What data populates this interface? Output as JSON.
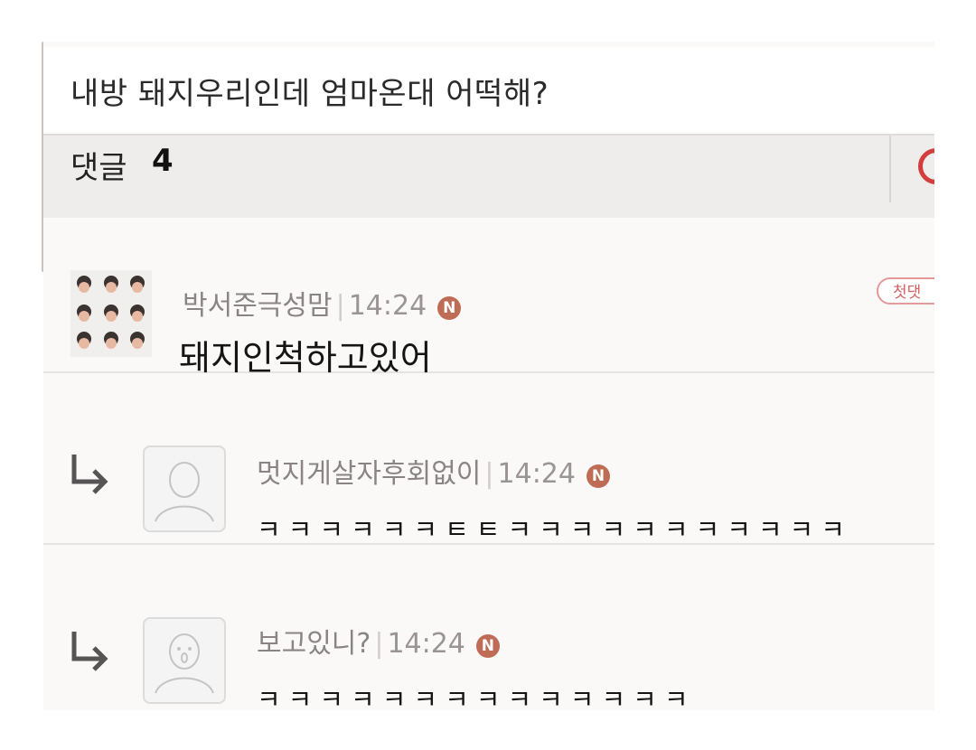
{
  "post": {
    "title": "내방 돼지우리인데 엄마온대 어떡해?"
  },
  "comments_bar": {
    "label": "댓글",
    "count": "4"
  },
  "comments": [
    {
      "author": "박서준극성맘",
      "time": "14:24",
      "badge": "N",
      "text": "돼지인척하고있어",
      "tag": "첫댓"
    },
    {
      "author": "멋지게살자후회없이",
      "time": "14:24",
      "badge": "N",
      "text": "ㅋㅋㅋㅋㅋㅋㅌㅌㅋㅋㅋㅋㅋㅋㅋㅋㅋㅋㅋ"
    },
    {
      "author": "보고있니?",
      "time": "14:24",
      "badge": "N",
      "text": "ㅋㅋㅋㅋㅋㅋㅋㅋㅋㅋㅋㅋㅋㅋ"
    }
  ],
  "colors": {
    "badge": "#bf6c57",
    "accent_red": "#d23d3d"
  },
  "icons": [
    "reply-arrow-icon",
    "default-avatar-icon",
    "new-badge-icon"
  ]
}
